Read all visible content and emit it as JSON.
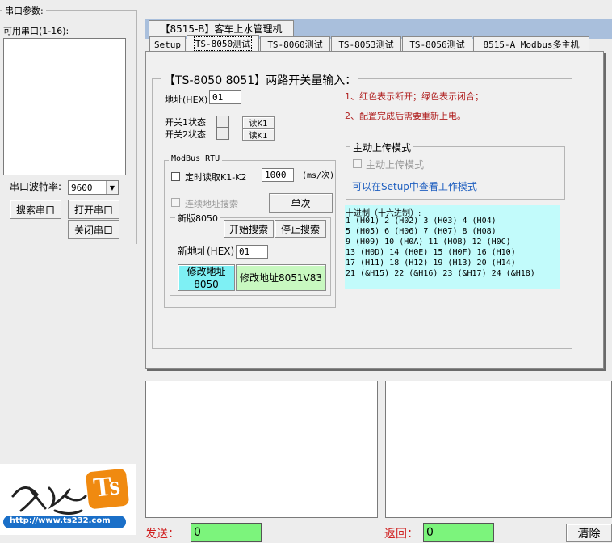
{
  "left": {
    "serial_params_label": "串口参数:",
    "available_ports_label": "可用串口(1-16):",
    "baud_label": "串口波特率:",
    "baud_value": "9600",
    "search_port": "搜索串口",
    "open_port": "打开串口",
    "close_port": "关闭串口",
    "logo_text": "Ts",
    "logo_url": "http://www.ts232.com"
  },
  "top_tab": "【8515-B】客车上水管理机",
  "tabs": [
    "Setup",
    "TS-8050测试",
    "TS-8060测试",
    "TS-8053测试",
    "TS-8056测试",
    "8515-A Modbus多主机"
  ],
  "panel": {
    "title": "【TS-8050 8051】两路开关量输入：",
    "address_label": "地址(HEX)",
    "address_value": "01",
    "switch1_label": "开关1状态",
    "switch2_label": "开关2状态",
    "read_k1": "读K1",
    "read_k1_2": "读K1",
    "note1": "1、红色表示断开；绿色表示闭合；",
    "note2": "2、配置完成后需要重新上电。",
    "modbus": {
      "legend": "ModBus RTU",
      "timed_read_label": "定时读取K1-K2",
      "interval_value": "1000",
      "interval_unit": "(ms/次)",
      "continuous_search_label": "连续地址搜索",
      "single_button": "单次",
      "new_8050": {
        "legend": "新版8050",
        "start_search": "开始搜索",
        "stop_search": "停止搜索",
        "new_address_label": "新地址(HEX)",
        "new_address_value": "01",
        "modify_8050": "修改地址\n8050",
        "modify_8051": "修改地址8051V83"
      }
    },
    "upload": {
      "legend": "主动上传模式",
      "checkbox_label": "主动上传模式",
      "link_text": "可以在Setup中查看工作模式"
    },
    "hex_table": {
      "title": "十进制（十六进制）:",
      "lines": [
        "1 (H01)  2 (H02)   3 (H03)  4 (H04)",
        "5 (H05)  6 (H06)   7 (H07)  8 (H08)",
        "9 (H09)  10 (H0A)   11 (H0B)  12 (H0C)",
        "13 (H0D) 14 (H0E)  15 (H0F)  16 (H10)",
        "17 (H11) 18 (H12)  19 (H13)  20 (H14)",
        "21 (&H15)  22 (&H16)  23 (&H17)  24 (&H18)"
      ]
    }
  },
  "bottom": {
    "send_label": "发送：",
    "send_value": "0",
    "return_label": "返回：",
    "return_value": "0",
    "clear": "清除"
  },
  "colors": {
    "tab_strip": "#a9bfdc",
    "note_red": "#b02020",
    "hex_bg": "#c2fbfb",
    "link_blue": "#2060c0",
    "modify_8050_bg": "#7ef0f4",
    "modify_8051_bg": "#c8f8c0",
    "counter_bg": "#7cf47c"
  }
}
